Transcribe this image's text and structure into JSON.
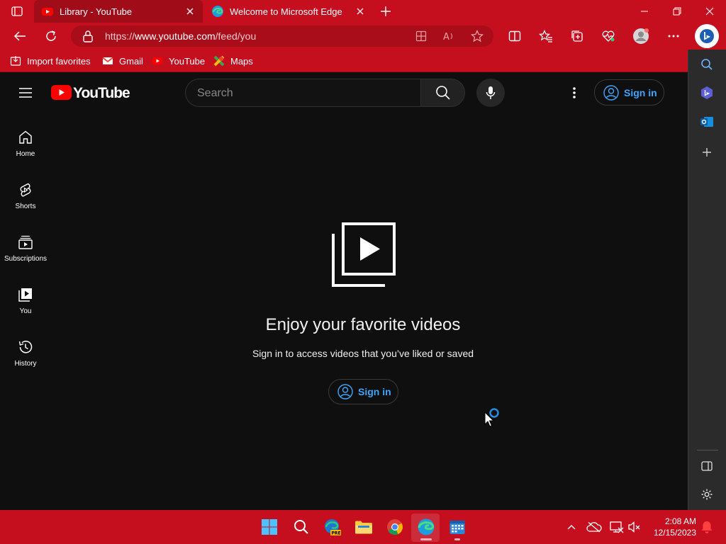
{
  "browser": {
    "tabs": [
      {
        "title": "Library - YouTube",
        "active": true,
        "favicon": "youtube-icon"
      },
      {
        "title": "Welcome to Microsoft Edge",
        "active": false,
        "favicon": "edge-icon"
      }
    ],
    "url_prefix": "https://",
    "url_host": "www.youtube.com",
    "url_path": "/feed/you",
    "favorites": [
      {
        "label": "Import favorites",
        "icon": "import-icon"
      },
      {
        "label": "Gmail",
        "icon": "gmail-icon"
      },
      {
        "label": "YouTube",
        "icon": "youtube-icon"
      },
      {
        "label": "Maps",
        "icon": "maps-icon"
      }
    ],
    "accent_color": "#c50f1f"
  },
  "youtube": {
    "logo_text": "YouTube",
    "search_placeholder": "Search",
    "signin_label": "Sign in",
    "guide": [
      {
        "label": "Home",
        "icon": "home-icon"
      },
      {
        "label": "Shorts",
        "icon": "shorts-icon"
      },
      {
        "label": "Subscriptions",
        "icon": "subscriptions-icon"
      },
      {
        "label": "You",
        "icon": "you-icon"
      },
      {
        "label": "History",
        "icon": "history-icon"
      }
    ],
    "empty_title": "Enjoy your favorite videos",
    "empty_subtitle": "Sign in to access videos that you’ve liked or saved",
    "link_color": "#3ea6ff"
  },
  "taskbar": {
    "time": "2:08 AM",
    "date": "12/15/2023"
  }
}
